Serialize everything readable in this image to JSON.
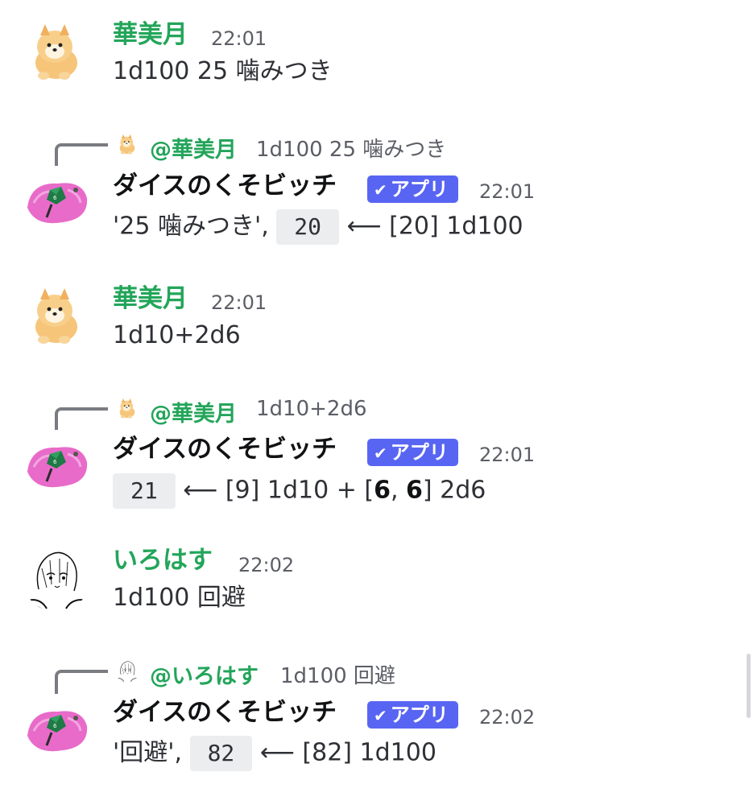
{
  "messages": [
    {
      "author": "華美月",
      "time": "22:01",
      "text": "1d100 25 噛みつき"
    },
    {
      "reply_to": {
        "mention": "@華美月",
        "text": "1d100 25 噛みつき"
      },
      "author": "ダイスのくそビッチ",
      "badge": "アプリ",
      "time": "22:01",
      "prefix": "'25 噛みつき',",
      "result": "20",
      "arrow": "⟵",
      "detail": "[20] 1d100"
    },
    {
      "author": "華美月",
      "time": "22:01",
      "text": "1d10+2d6"
    },
    {
      "reply_to": {
        "mention": "@華美月",
        "text": "1d10+2d6"
      },
      "author": "ダイスのくそビッチ",
      "badge": "アプリ",
      "time": "22:01",
      "result": "21",
      "arrow": "⟵",
      "detail_parts": {
        "a": "[9] 1d10 + [",
        "b": "6",
        "c": ", ",
        "d": "6",
        "e": "] 2d6"
      }
    },
    {
      "author": "いろはす",
      "time": "22:02",
      "text": "1d100 回避"
    },
    {
      "reply_to": {
        "mention": "@いろはす",
        "text": "1d100 回避"
      },
      "author": "ダイスのくそビッチ",
      "badge": "アプリ",
      "time": "22:02",
      "prefix": "'回避',",
      "result": "82",
      "arrow": "⟵",
      "detail": "[82] 1d100"
    }
  ],
  "colors": {
    "username_green": "#23a55a",
    "app_badge": "#5865f2",
    "code_bg": "#ebedef"
  },
  "icons": {
    "badge_check": "checkmark-icon"
  }
}
